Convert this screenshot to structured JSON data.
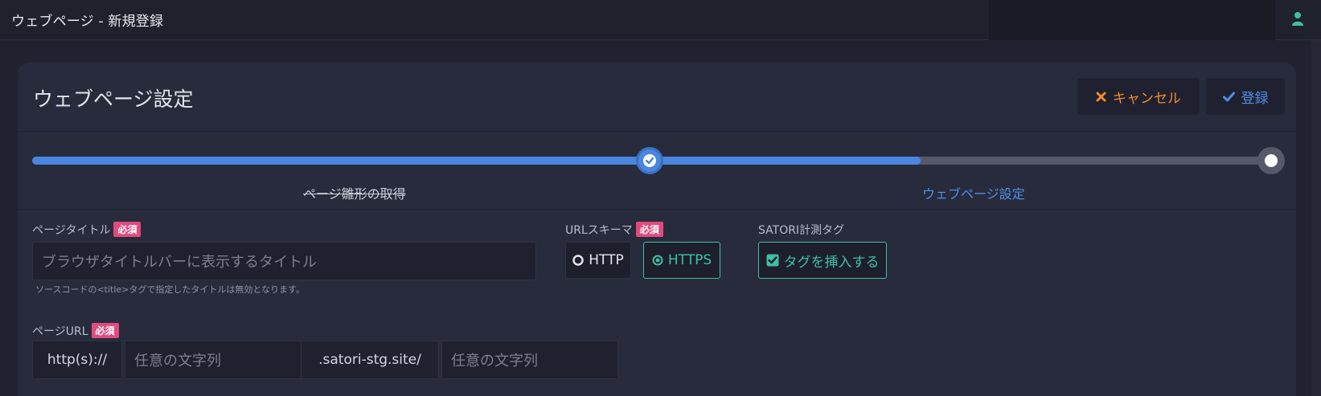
{
  "topbar": {
    "title": "ウェブページ - 新規登録",
    "user_icon": "user-icon"
  },
  "card": {
    "title": "ウェブページ設定",
    "cancel_label": "キャンセル",
    "submit_label": "登録"
  },
  "progress": {
    "fill_fraction": 0.71,
    "steps": [
      {
        "label": "ページ雛形の取得",
        "status": "done"
      },
      {
        "label": "ウェブページ設定",
        "status": "current"
      }
    ]
  },
  "form": {
    "page_title": {
      "label": "ページタイトル",
      "required_badge": "必須",
      "placeholder": "ブラウザタイトルバーに表示するタイトル",
      "helper": "ソースコードの<title>タグで指定したタイトルは無効となります。"
    },
    "url_scheme": {
      "label": "URLスキーマ",
      "required_badge": "必須",
      "options": [
        "HTTP",
        "HTTPS"
      ],
      "selected": "HTTPS"
    },
    "tracking_tag": {
      "label": "SATORI計測タグ",
      "checkbox_label": "タグを挿入する",
      "checked": true
    },
    "page_url": {
      "label": "ページURL",
      "required_badge": "必須",
      "prefix": "http(s)://",
      "subdomain_placeholder": "任意の文字列",
      "domain": ".satori-stg.site/",
      "path_placeholder": "任意の文字列"
    }
  },
  "colors": {
    "accent_blue": "#4a86df",
    "cancel_orange": "#f28a2d",
    "teal": "#3fbfa4",
    "badge_pink": "#e04b7e"
  }
}
